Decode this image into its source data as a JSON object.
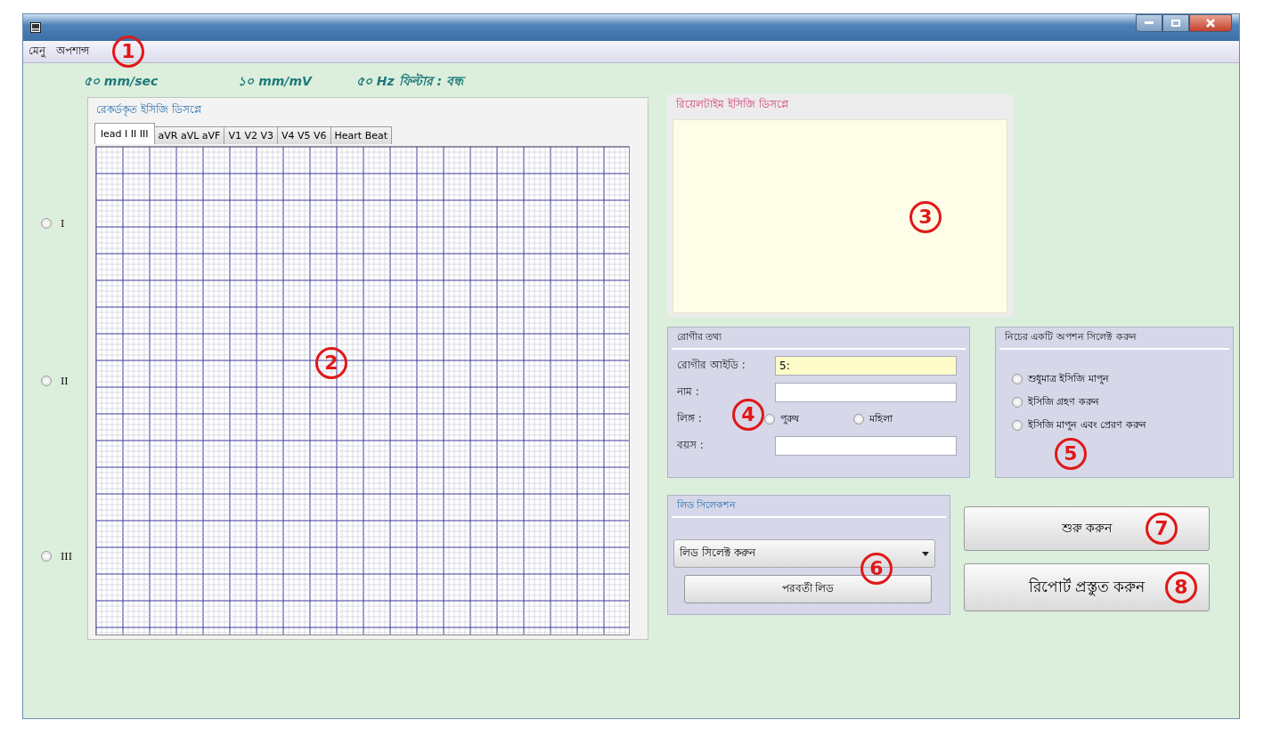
{
  "menu": {
    "items": [
      "মেনু",
      "অপশান্স"
    ],
    "callout": "1"
  },
  "settings": [
    "৫০ mm/sec",
    "১০ mm/mV",
    "৫০ Hz ফিল্টার : বন্ধ"
  ],
  "lead_radios": [
    {
      "label": "I",
      "selected": false
    },
    {
      "label": "II",
      "selected": false
    },
    {
      "label": "III",
      "selected": false
    }
  ],
  "recorded_display": {
    "title": "রেকর্ডকৃত ইসিজি ডিসপ্লে",
    "callout": "2",
    "tabs": [
      {
        "label": "lead I II III",
        "selected": true
      },
      {
        "label": "aVR aVL aVF",
        "selected": false
      },
      {
        "label": "V1 V2 V3",
        "selected": false
      },
      {
        "label": "V4 V5 V6",
        "selected": false
      },
      {
        "label": "Heart Beat",
        "selected": false
      }
    ]
  },
  "realtime_display": {
    "title": "রিয়েলটাইম ইসিজি ডিসপ্লে",
    "callout": "3"
  },
  "patient_info": {
    "title": "রোগীর তথ্য",
    "callout": "4",
    "id_label": "রোগীর আইডি :",
    "id_value": "5:",
    "name_label": "নাম :",
    "gender_label": "লিঙ্গ :",
    "genders": [
      {
        "label": "পুরুষ",
        "selected": false
      },
      {
        "label": "মহিলা",
        "selected": false
      }
    ],
    "age_label": "বয়স :"
  },
  "options": {
    "title": "নিচের একটি অপশন সিলেক্ট করুন",
    "callout": "5",
    "items": [
      {
        "label": "শুধুমাত্র ইসিজি মাপুন",
        "selected": false
      },
      {
        "label": "ইসিজি গ্রহণ করুন",
        "selected": false
      },
      {
        "label": "ইসিজি মাপুন এবং প্রেরণ করুন",
        "selected": false
      }
    ]
  },
  "lead_selection": {
    "title": "লিড সিলেকশন",
    "callout": "6",
    "dropdown": "লিড সিলেক্ট করুন",
    "next_button": "পরবর্তী লিড"
  },
  "start_button": {
    "label": "শুরু করুন",
    "callout": "7"
  },
  "report_button": {
    "label": "রিপোর্ট প্রস্তুত করুন",
    "callout": "8"
  }
}
